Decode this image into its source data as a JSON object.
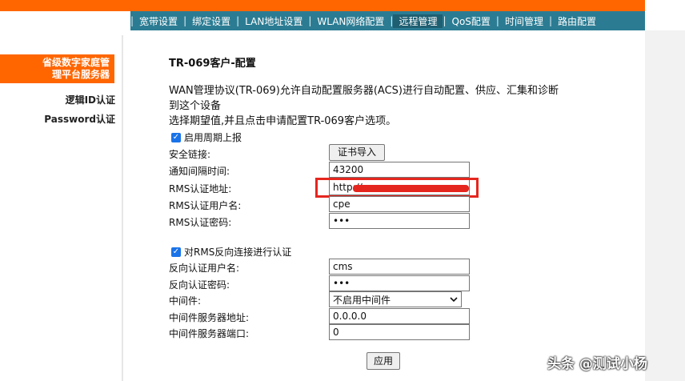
{
  "nav": {
    "items": [
      "宽带设置",
      "绑定设置",
      "LAN地址设置",
      "WLAN网络配置",
      "远程管理",
      "QoS配置",
      "时间管理",
      "路由配置"
    ],
    "separator": "|"
  },
  "sidebar": {
    "title_line1": "省级数字家庭管",
    "title_line2": "理平台服务器",
    "links": [
      "逻辑ID认证",
      "Password认证"
    ]
  },
  "page": {
    "title": "TR-069客户-配置",
    "desc_line1": "WAN管理协议(TR-069)允许自动配置服务器(ACS)进行自动配置、供应、汇集和诊断",
    "desc_line2": "到这个设备",
    "desc_line3": "选择期望值,并且点击申请配置TR-069客户选项。"
  },
  "form": {
    "periodic_label": "启用周期上报",
    "secure_link_label": "安全链接:",
    "cert_button": "证书导入",
    "notify_interval_label": "通知间隔时间:",
    "notify_interval_value": "43200",
    "rms_url_label": "RMS认证地址:",
    "rms_url_value": "http://",
    "rms_user_label": "RMS认证用户名:",
    "rms_user_value": "cpe",
    "rms_pass_label": "RMS认证密码:",
    "rms_pass_value": "•••",
    "reverse_auth_label": "对RMS反向连接进行认证",
    "reverse_user_label": "反向认证用户名:",
    "reverse_user_value": "cms",
    "reverse_pass_label": "反向认证密码:",
    "reverse_pass_value": "•••",
    "middleware_label": "中间件:",
    "middleware_value": "不启用中间件",
    "middleware_addr_label": "中间件服务器地址:",
    "middleware_addr_value": "0.0.0.0",
    "middleware_port_label": "中间件服务器端口:",
    "middleware_port_value": "0",
    "apply_button": "应用"
  },
  "watermark": "头条 @测试小杨",
  "colors": {
    "accent": "#ff6600",
    "nav": "#2b7c93",
    "highlight": "#e5261f"
  }
}
